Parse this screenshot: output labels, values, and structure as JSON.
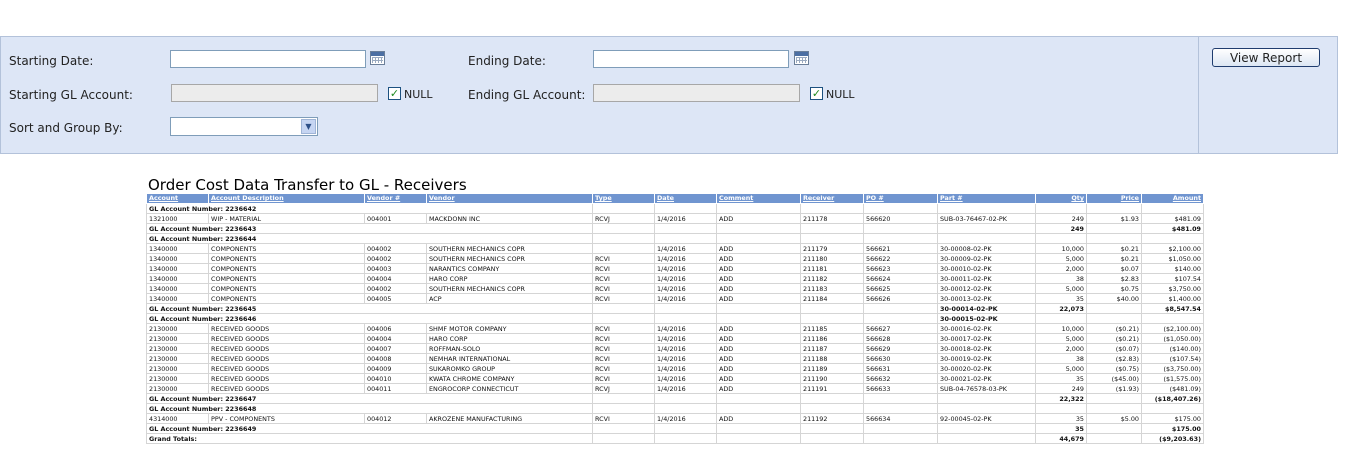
{
  "filters": {
    "starting_date_label": "Starting Date:",
    "ending_date_label": "Ending Date:",
    "starting_gl_label": "Starting GL Account:",
    "ending_gl_label": "Ending GL Account:",
    "sort_label": "Sort and Group By:",
    "null_label": "NULL",
    "check_mark": "✓",
    "starting_date_value": "",
    "ending_date_value": "",
    "starting_gl_value": "",
    "ending_gl_value": "",
    "sort_value": ""
  },
  "actions": {
    "view_report_label": "View Report"
  },
  "report": {
    "title": "Order Cost Data Transfer to GL - Receivers",
    "columns": [
      "Account",
      "Account Description",
      "Vendor #",
      "Vendor",
      "Type",
      "Date",
      "Comment",
      "Receiver",
      "PO #",
      "Part #",
      "Qty",
      "Price",
      "Amount"
    ],
    "rows": [
      {
        "kind": "group",
        "text": "GL Account Number: 2236642"
      },
      {
        "kind": "data",
        "cells": [
          "1321000",
          "WIP - MATERIAL",
          "004001",
          "MACKDONN INC",
          "RCVJ",
          "1/4/2016",
          "ADD",
          "211178",
          "566620",
          "SUB-03-76467-02-PK",
          "249",
          "$1.93",
          "$481.09"
        ]
      },
      {
        "kind": "subtotal",
        "text": "GL Account Number: 2236643",
        "part": "",
        "qty": "249",
        "amount": "$481.09"
      },
      {
        "kind": "group",
        "text": "GL Account Number: 2236644"
      },
      {
        "kind": "data",
        "cells": [
          "1340000",
          "COMPONENTS",
          "004002",
          "SOUTHERN MECHANICS COPR",
          "",
          "1/4/2016",
          "ADD",
          "211179",
          "566621",
          "30-00008-02-PK",
          "10,000",
          "$0.21",
          "$2,100.00"
        ]
      },
      {
        "kind": "data",
        "cells": [
          "1340000",
          "COMPONENTS",
          "004002",
          "SOUTHERN MECHANICS COPR",
          "RCVI",
          "1/4/2016",
          "ADD",
          "211180",
          "566622",
          "30-00009-02-PK",
          "5,000",
          "$0.21",
          "$1,050.00"
        ]
      },
      {
        "kind": "data",
        "cells": [
          "1340000",
          "COMPONENTS",
          "004003",
          "NARANTICS COMPANY",
          "RCVI",
          "1/4/2016",
          "ADD",
          "211181",
          "566623",
          "30-00010-02-PK",
          "2,000",
          "$0.07",
          "$140.00"
        ]
      },
      {
        "kind": "data",
        "cells": [
          "1340000",
          "COMPONENTS",
          "004004",
          "HARO CORP",
          "RCVI",
          "1/4/2016",
          "ADD",
          "211182",
          "566624",
          "30-00011-02-PK",
          "38",
          "$2.83",
          "$107.54"
        ]
      },
      {
        "kind": "data",
        "cells": [
          "1340000",
          "COMPONENTS",
          "004002",
          "SOUTHERN MECHANICS COPR",
          "RCVI",
          "1/4/2016",
          "ADD",
          "211183",
          "566625",
          "30-00012-02-PK",
          "5,000",
          "$0.75",
          "$3,750.00"
        ]
      },
      {
        "kind": "data",
        "cells": [
          "1340000",
          "COMPONENTS",
          "004005",
          "ACP",
          "RCVI",
          "1/4/2016",
          "ADD",
          "211184",
          "566626",
          "30-00013-02-PK",
          "35",
          "$40.00",
          "$1,400.00"
        ]
      },
      {
        "kind": "subtotal",
        "text": "GL Account Number: 2236645",
        "part": "30-00014-02-PK",
        "qty": "22,073",
        "amount": "$8,547.54"
      },
      {
        "kind": "subtotal",
        "text": "GL Account Number: 2236646",
        "part": "30-00015-02-PK",
        "qty": "",
        "amount": ""
      },
      {
        "kind": "data",
        "cells": [
          "2130000",
          "RECEIVED GOODS",
          "004006",
          "SHMF MOTOR COMPANY",
          "RCVI",
          "1/4/2016",
          "ADD",
          "211185",
          "566627",
          "30-00016-02-PK",
          "10,000",
          "($0.21)",
          "($2,100.00)"
        ]
      },
      {
        "kind": "data",
        "cells": [
          "2130000",
          "RECEIVED GOODS",
          "004004",
          "HARO CORP",
          "RCVI",
          "1/4/2016",
          "ADD",
          "211186",
          "566628",
          "30-00017-02-PK",
          "5,000",
          "($0.21)",
          "($1,050.00)"
        ]
      },
      {
        "kind": "data",
        "cells": [
          "2130000",
          "RECEIVED GOODS",
          "004007",
          "ROFFMAN-SOLO",
          "RCVI",
          "1/4/2016",
          "ADD",
          "211187",
          "566629",
          "30-00018-02-PK",
          "2,000",
          "($0.07)",
          "($140.00)"
        ]
      },
      {
        "kind": "data",
        "cells": [
          "2130000",
          "RECEIVED GOODS",
          "004008",
          "NEMHAR INTERNATIONAL",
          "RCVI",
          "1/4/2016",
          "ADD",
          "211188",
          "566630",
          "30-00019-02-PK",
          "38",
          "($2.83)",
          "($107.54)"
        ]
      },
      {
        "kind": "data",
        "cells": [
          "2130000",
          "RECEIVED GOODS",
          "004009",
          "SUKAROMKO GROUP",
          "RCVI",
          "1/4/2016",
          "ADD",
          "211189",
          "566631",
          "30-00020-02-PK",
          "5,000",
          "($0.75)",
          "($3,750.00)"
        ]
      },
      {
        "kind": "data",
        "cells": [
          "2130000",
          "RECEIVED GOODS",
          "004010",
          "KWATA CHROME COMPANY",
          "RCVI",
          "1/4/2016",
          "ADD",
          "211190",
          "566632",
          "30-00021-02-PK",
          "35",
          "($45.00)",
          "($1,575.00)"
        ]
      },
      {
        "kind": "data",
        "cells": [
          "2130000",
          "RECEIVED GOODS",
          "004011",
          "ENGROCORP CONNECTICUT",
          "RCVJ",
          "1/4/2016",
          "ADD",
          "211191",
          "566633",
          "SUB-04-76578-03-PK",
          "249",
          "($1.93)",
          "($481.09)"
        ]
      },
      {
        "kind": "subtotal",
        "text": "GL Account Number: 2236647",
        "part": "",
        "qty": "22,322",
        "amount": "($18,407.26)"
      },
      {
        "kind": "group",
        "text": "GL Account Number: 2236648"
      },
      {
        "kind": "data",
        "cells": [
          "4314000",
          "PPV - COMPONENTS",
          "004012",
          "AKROZENE MANUFACTURING",
          "RCVI",
          "1/4/2016",
          "ADD",
          "211192",
          "566634",
          "92-00045-02-PK",
          "35",
          "$5.00",
          "$175.00"
        ]
      },
      {
        "kind": "subtotal",
        "text": "GL Account Number: 2236649",
        "part": "",
        "qty": "35",
        "amount": "$175.00"
      },
      {
        "kind": "total",
        "text": "Grand Totals:",
        "part": "",
        "qty": "44,679",
        "amount": "($9,203.63)"
      }
    ]
  },
  "colors": {
    "panel_bg": "#dde6f6",
    "table_header_bg": "#7095d0",
    "check_color": "#1f8a1f"
  }
}
